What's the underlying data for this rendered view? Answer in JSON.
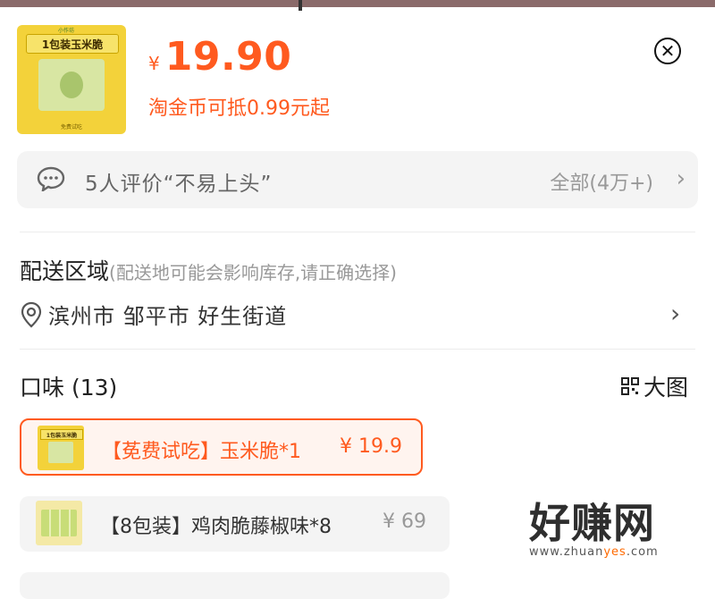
{
  "product": {
    "thumb_label": "1包装玉米脆",
    "thumb_brand": "小作坊",
    "thumb_small": "免费试吃",
    "currency": "¥",
    "price": "19.90",
    "coin_note": "淘金币可抵0.99元起"
  },
  "reviews": {
    "summary": "5人评价“不易上头”",
    "all_label": "全部(4万+)"
  },
  "delivery": {
    "title": "配送区域",
    "note": "(配送地可能会影响库存,请正确选择)",
    "address": "滨州市 邹平市 好生街道"
  },
  "flavor": {
    "title": "口味 (13)",
    "big_pic_label": "大图",
    "options": [
      {
        "name": "【莬费试吃】玉米脆*1",
        "price": "¥ 19.9",
        "thumb_label": "1包装玉米脆",
        "selected": true
      },
      {
        "name": "【8包装】鸡肉脆藤椒味*8",
        "price": "¥ 69",
        "selected": false
      }
    ]
  },
  "watermark": {
    "text": "好赚网",
    "url_a": "www.zhuan",
    "url_b": "yes",
    "url_c": ".com"
  },
  "colors": {
    "accent": "#ff5a1f",
    "muted": "#999999",
    "panel": "#f4f4f4"
  },
  "icons": [
    "close-icon",
    "chat-bubble-icon",
    "chevron-right-icon",
    "location-pin-icon",
    "grid-icon"
  ]
}
